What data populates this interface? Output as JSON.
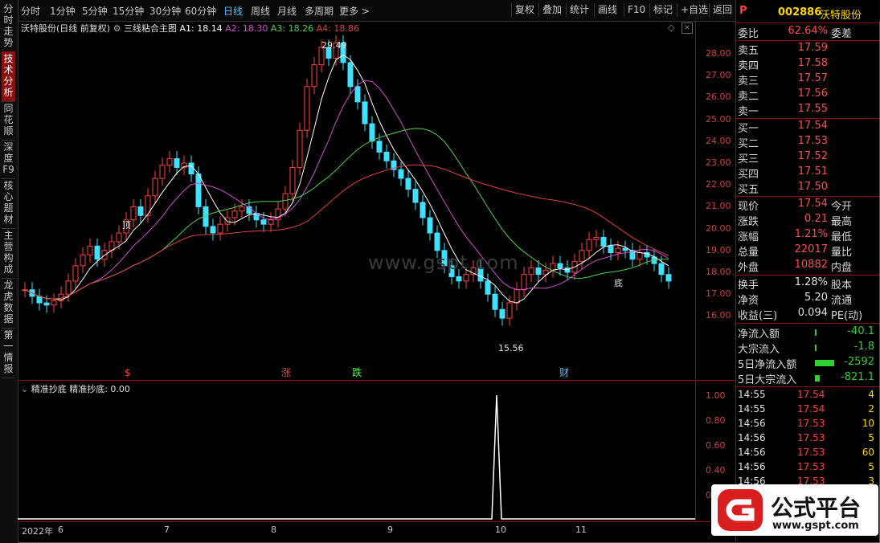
{
  "toolbar": {
    "periods": [
      "分时",
      "1分钟",
      "5分钟",
      "15分钟",
      "30分钟",
      "60分钟",
      "日线",
      "周线",
      "月线",
      "多周期",
      "更多 >"
    ],
    "active_period": "日线",
    "buttons": [
      "复权",
      "叠加",
      "统计",
      "画线",
      "F10",
      "标记",
      "+自选",
      "返回"
    ]
  },
  "left_tabs": [
    "分时走势",
    "技术分析",
    "同花顺",
    "深度F9",
    "核心题材",
    "主营构成",
    "龙虎数据",
    "第一情报"
  ],
  "chart": {
    "stock_title": "沃特股份(日线 前复权)",
    "indicator": "三线粘合主图",
    "ma": [
      {
        "label": "A1: 18.14",
        "color": "#ffffff"
      },
      {
        "label": "A2: 18.30",
        "color": "#d050d0"
      },
      {
        "label": "A3: 18.26",
        "color": "#50d050"
      },
      {
        "label": "A4: 18.86",
        "color": "#e04040"
      }
    ],
    "high_label": "29.49",
    "low_label": "15.56",
    "ding_label": "顶",
    "dibu_label": "底",
    "event_marks": [
      {
        "text": "$",
        "color": "#ff4040"
      },
      {
        "text": "涨",
        "color": "#ff4040"
      },
      {
        "text": "跌",
        "color": "#40ff40"
      },
      {
        "text": "财",
        "color": "#4fc3ff"
      }
    ],
    "y_ticks": [
      "28.00",
      "27.00",
      "26.00",
      "25.00",
      "24.00",
      "23.00",
      "22.00",
      "21.00",
      "20.00",
      "19.00",
      "18.00",
      "17.00",
      "16.00"
    ],
    "watermark": "www.gspt.com"
  },
  "sub_chart": {
    "title": "精准抄底",
    "value_label": "精准抄底: 0.00",
    "y_ticks": [
      "1.00",
      "0.80",
      "0.60",
      "0.40",
      "0.20"
    ]
  },
  "x_axis": [
    "2022年",
    "6",
    "7",
    "8",
    "9",
    "10",
    "11"
  ],
  "quote": {
    "code": "002886",
    "name": "沃特股份",
    "wei_bi_label": "委比",
    "wei_bi": "62.64%",
    "wei_cha_label": "委差",
    "asks": [
      {
        "label": "卖五",
        "price": "17.59"
      },
      {
        "label": "卖四",
        "price": "17.58"
      },
      {
        "label": "卖三",
        "price": "17.57"
      },
      {
        "label": "卖二",
        "price": "17.56"
      },
      {
        "label": "卖一",
        "price": "17.55"
      }
    ],
    "bids": [
      {
        "label": "买一",
        "price": "17.54"
      },
      {
        "label": "买二",
        "price": "17.53"
      },
      {
        "label": "买三",
        "price": "17.52"
      },
      {
        "label": "买四",
        "price": "17.51"
      },
      {
        "label": "买五",
        "price": "17.50"
      }
    ],
    "stats": [
      {
        "label": "现价",
        "value": "17.54",
        "label2": "今开"
      },
      {
        "label": "涨跌",
        "value": "0.21",
        "label2": "最高"
      },
      {
        "label": "涨幅",
        "value": "1.21%",
        "label2": "最低"
      },
      {
        "label": "总量",
        "value": "22017",
        "label2": "量比"
      },
      {
        "label": "外盘",
        "value": "10882",
        "label2": "内盘"
      }
    ],
    "stats2": [
      {
        "label": "换手",
        "value": "1.28%",
        "label2": "股本"
      },
      {
        "label": "净资",
        "value": "5.20",
        "label2": "流通"
      },
      {
        "label": "收益(三)",
        "value": "0.094",
        "label2": "PE(动)"
      }
    ],
    "flows": [
      {
        "label": "净流入额",
        "value": "-40.1"
      },
      {
        "label": "大宗流入",
        "value": "-1.8"
      },
      {
        "label": "5日净流入额",
        "value": "-2592"
      },
      {
        "label": "5日大宗流入",
        "value": "-821.1"
      }
    ],
    "ticks": [
      {
        "time": "14:55",
        "price": "17.54",
        "vol": "4"
      },
      {
        "time": "14:55",
        "price": "17.54",
        "vol": "2"
      },
      {
        "time": "14:56",
        "price": "17.53",
        "vol": "10"
      },
      {
        "time": "14:56",
        "price": "17.53",
        "vol": "5"
      },
      {
        "time": "14:56",
        "price": "17.53",
        "vol": "60"
      },
      {
        "time": "14:56",
        "price": "17.53",
        "vol": "5"
      },
      {
        "time": "14:56",
        "price": "17.53",
        "vol": "3"
      }
    ]
  },
  "logo": {
    "text": "公式平台",
    "url": "www.gspt.com"
  }
}
